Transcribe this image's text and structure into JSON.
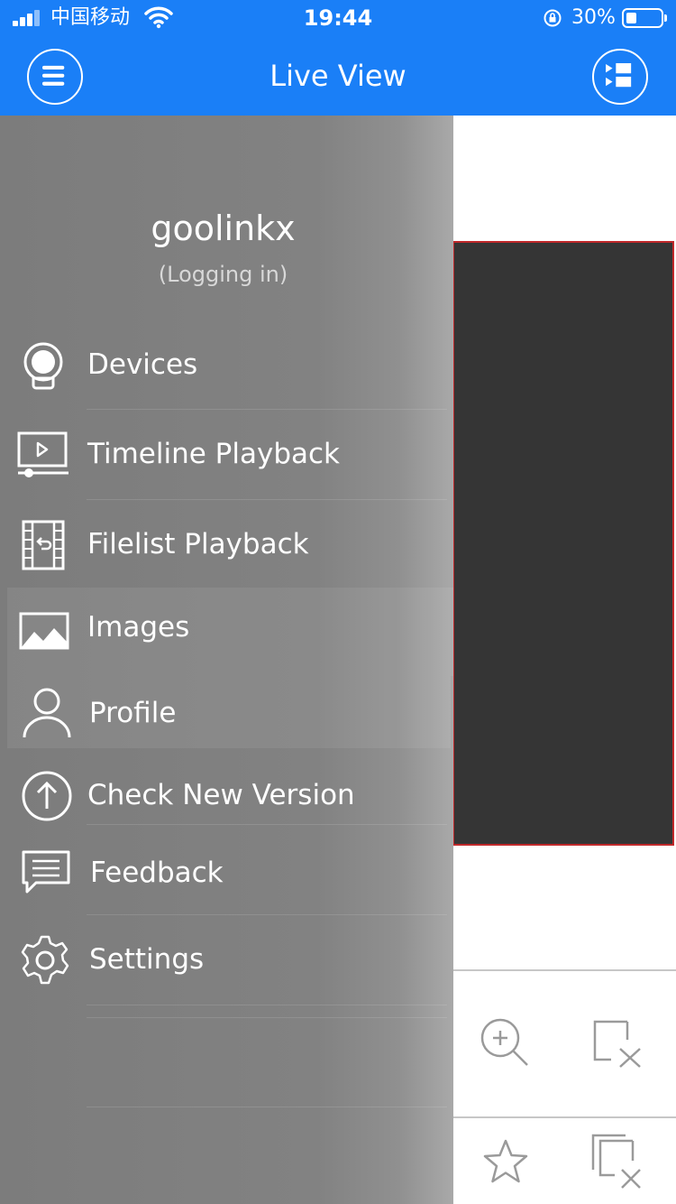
{
  "status_bar": {
    "carrier": "中国移动",
    "time": "19:44",
    "battery": "30%",
    "battery_level": 0.3
  },
  "nav": {
    "title": "Live View",
    "left_icon": "menu-icon",
    "right_icon": "split-screen-icon"
  },
  "drawer": {
    "username": "goolinkx",
    "status": "(Logging in)",
    "items": [
      {
        "label": "Devices",
        "icon": "camera-icon"
      },
      {
        "label": "Timeline Playback",
        "icon": "timeline-playback-icon"
      },
      {
        "label": "Filelist Playback",
        "icon": "film-icon"
      },
      {
        "label": "Images",
        "icon": "image-icon"
      },
      {
        "label": "Profile",
        "icon": "user-icon"
      },
      {
        "label": "Check New Version",
        "icon": "upload-arrow-icon"
      },
      {
        "label": "Feedback",
        "icon": "chat-icon"
      },
      {
        "label": "Settings",
        "icon": "gear-icon"
      }
    ]
  },
  "toolbar": {
    "icons": [
      "zoom-in-icon",
      "close-window-icon",
      "favorite-star-icon",
      "close-all-windows-icon"
    ]
  },
  "colors": {
    "accent": "#1a7ff7",
    "drawer_bg": "#828282",
    "video_bg": "#353535",
    "video_border": "#c0292b"
  }
}
